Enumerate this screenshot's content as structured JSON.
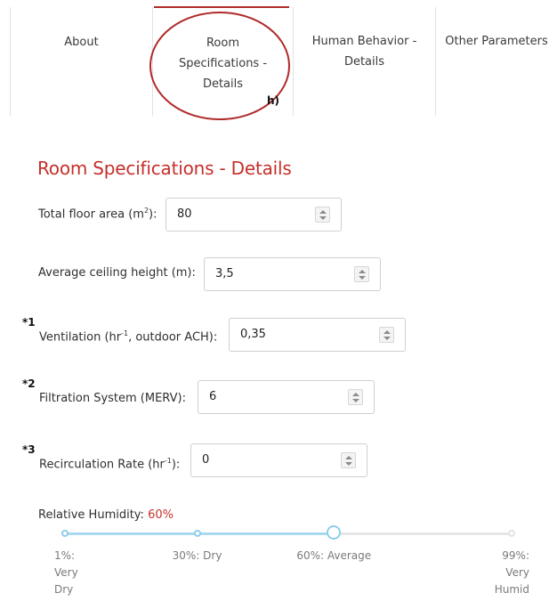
{
  "tabs": [
    {
      "label": "About",
      "active": false
    },
    {
      "label": "Room\nSpecifications -\nDetails",
      "active": true
    },
    {
      "label": "Human Behavior -\nDetails",
      "active": false
    },
    {
      "label": "Other Parameters",
      "active": false
    }
  ],
  "annotation": {
    "tab_marker": "h)"
  },
  "section": {
    "title": "Room Specifications - Details"
  },
  "fields": {
    "floor_area": {
      "label_pre": "Total floor area (m",
      "label_sup": "2",
      "label_post": "):",
      "value": "80"
    },
    "ceiling_height": {
      "label": "Average ceiling height (m):",
      "value": "3,5"
    },
    "ventilation": {
      "star": "*1",
      "label_pre": "Ventilation (hr",
      "label_sup": "-1",
      "label_post": ", outdoor ACH):",
      "value": "0,35"
    },
    "filtration": {
      "star": "*2",
      "label": "Filtration System (MERV):",
      "value": "6"
    },
    "recirculation": {
      "star": "*3",
      "label_pre": "Recirculation Rate (hr",
      "label_sup": "-1",
      "label_post": "):",
      "value": "0"
    }
  },
  "humidity": {
    "label": "Relative Humidity:",
    "value_text": "60%",
    "value": 60,
    "min": 1,
    "max": 99,
    "ticks": [
      {
        "value": 1,
        "label": "1%:\nVery\nDry"
      },
      {
        "value": 30,
        "label": "30%: Dry"
      },
      {
        "value": 60,
        "label": "60%: Average"
      },
      {
        "value": 99,
        "label": "99%:\nVery\nHumid"
      }
    ]
  },
  "colors": {
    "accent": "#c4302b",
    "slider": "#8fcdea"
  },
  "icons": {
    "stepper": "up-down-stepper-icon"
  }
}
